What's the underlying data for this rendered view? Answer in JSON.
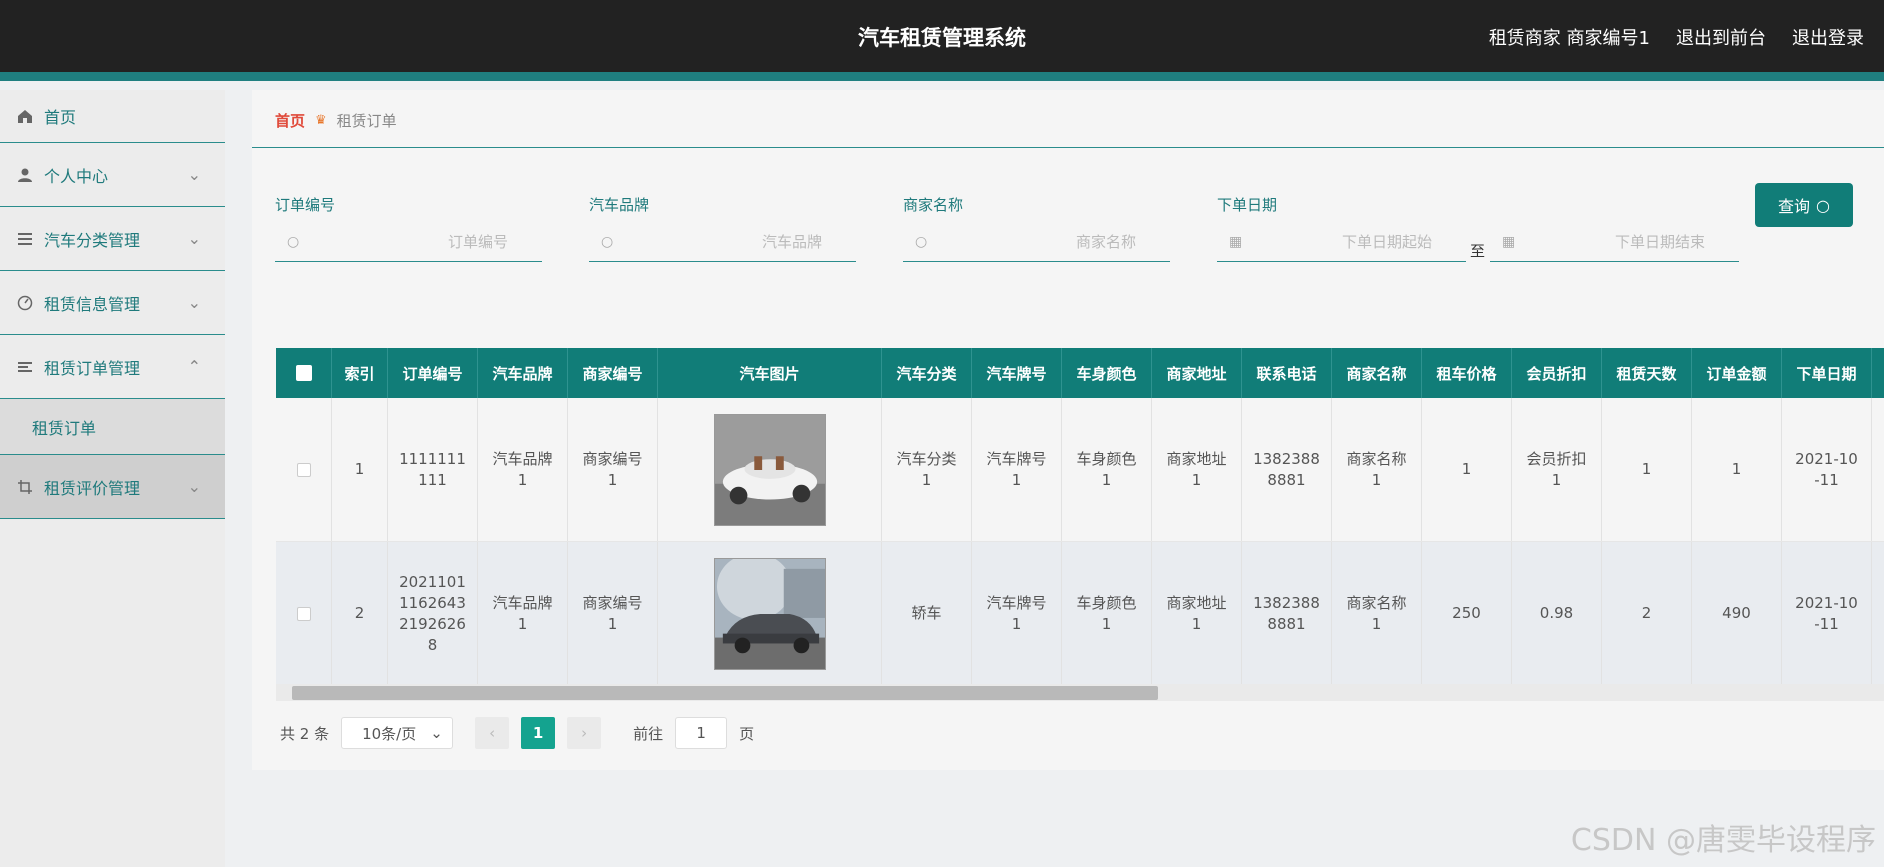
{
  "header": {
    "title": "汽车租赁管理系统",
    "user_label": "租赁商家 商家编号1",
    "to_front": "退出到前台",
    "logout": "退出登录"
  },
  "sidebar": {
    "items": [
      {
        "label": "首页",
        "icon": "home-icon"
      },
      {
        "label": "个人中心",
        "icon": "user-icon"
      },
      {
        "label": "汽车分类管理",
        "icon": "list-icon"
      },
      {
        "label": "租赁信息管理",
        "icon": "gauge-icon"
      },
      {
        "label": "租赁订单管理",
        "icon": "menu-icon"
      },
      {
        "label": "租赁评价管理",
        "icon": "crop-icon"
      }
    ],
    "submenu": {
      "label": "租赁订单"
    }
  },
  "breadcrumb": {
    "home": "首页",
    "current": "租赁订单"
  },
  "filters": {
    "order_no": {
      "label": "订单编号",
      "placeholder": "订单编号"
    },
    "brand": {
      "label": "汽车品牌",
      "placeholder": "汽车品牌"
    },
    "merchant": {
      "label": "商家名称",
      "placeholder": "商家名称"
    },
    "date": {
      "label": "下单日期",
      "start_placeholder": "下单日期起始",
      "end_placeholder": "下单日期结束",
      "to": "至"
    },
    "search_button": "查询"
  },
  "table": {
    "columns": [
      "索引",
      "订单编号",
      "汽车品牌",
      "商家编号",
      "汽车图片",
      "汽车分类",
      "汽车牌号",
      "车身颜色",
      "商家地址",
      "联系电话",
      "商家名称",
      "租车价格",
      "会员折扣",
      "租赁天数",
      "订单金额",
      "下单日期"
    ],
    "rows": [
      [
        "1",
        "1111111\n111",
        "汽车品牌\n1",
        "商家编号\n1",
        "",
        "汽车分类\n1",
        "汽车牌号\n1",
        "车身颜色\n1",
        "商家地址\n1",
        "1382388\n8881",
        "商家名称\n1",
        "1",
        "会员折扣\n1",
        "1",
        "1",
        "2021-10\n-11"
      ],
      [
        "2",
        "2021101\n1162643\n2192626\n8",
        "汽车品牌\n1",
        "商家编号\n1",
        "",
        "轿车",
        "汽车牌号\n1",
        "车身颜色\n1",
        "商家地址\n1",
        "1382388\n8881",
        "商家名称\n1",
        "250",
        "0.98",
        "2",
        "490",
        "2021-10\n-11"
      ]
    ]
  },
  "pagination": {
    "total": "共 2 条",
    "page_size": "10条/页",
    "current": "1",
    "goto": "前往",
    "goto_value": "1",
    "page_suffix": "页"
  },
  "watermark": "CSDN @唐雯毕设程序",
  "colors": {
    "accent": "#117d78",
    "topbar": "#222222",
    "active_page": "#14a38f"
  }
}
